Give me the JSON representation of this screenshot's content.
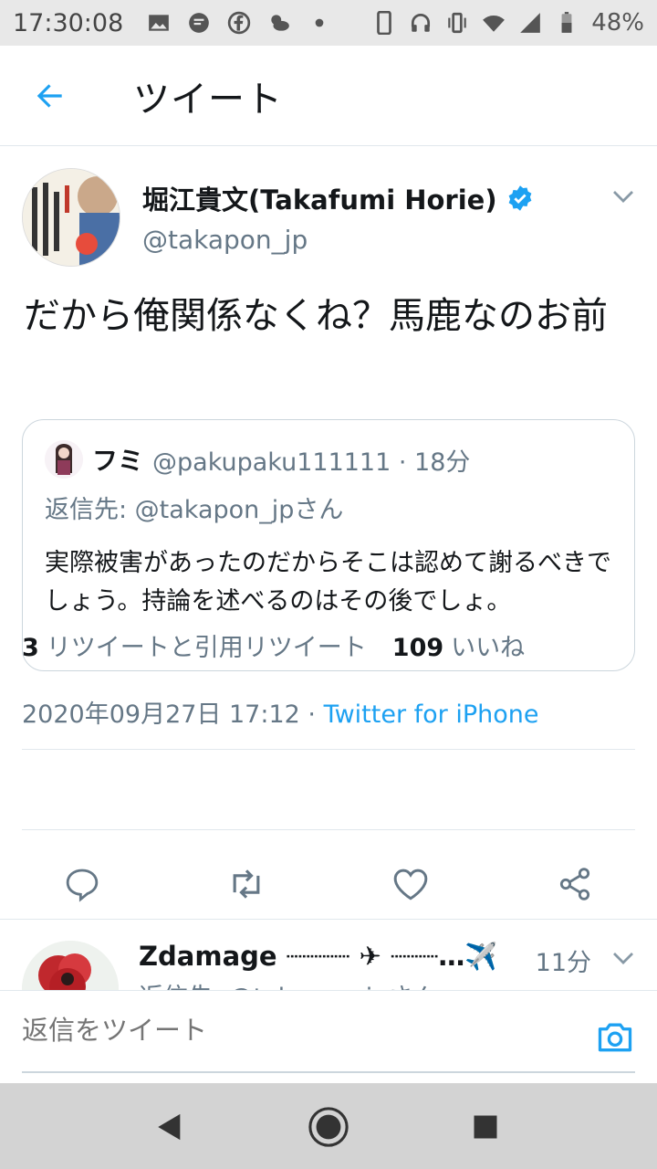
{
  "status_bar": {
    "time": "17:30:08",
    "battery": "48%"
  },
  "app_bar": {
    "title": "ツイート"
  },
  "tweet": {
    "author_name": "堀江貴文(Takafumi Horie)",
    "author_handle": "@takapon_jp",
    "text": "だから俺関係なくね？馬鹿なのお前",
    "timestamp": "2020年09月27日 17:12 · ",
    "source": "Twitter for iPhone",
    "retweet_count": "3",
    "retweet_label": "リツイートと引用リツイート",
    "like_count": "109",
    "like_label": "いいね"
  },
  "quote": {
    "name": "フミ",
    "meta": "@pakupaku111111 · 18分",
    "reply_to": "返信先: @takapon_jpさん",
    "text": "実際被害があったのだからそこは認めて謝るべきでしょう。持論を述べるのはその後でしょ。"
  },
  "reply": {
    "name": "Zdamage ┈┈┈┈ ✈ ┈┈┈…✈️",
    "time": "11分",
    "sub": "返信先: @takapon_jpさん"
  },
  "compose": {
    "placeholder": "返信をツイート"
  },
  "colors": {
    "accent": "#1da1f2",
    "secondary_text": "#657786",
    "divider": "#e1e8ed"
  }
}
